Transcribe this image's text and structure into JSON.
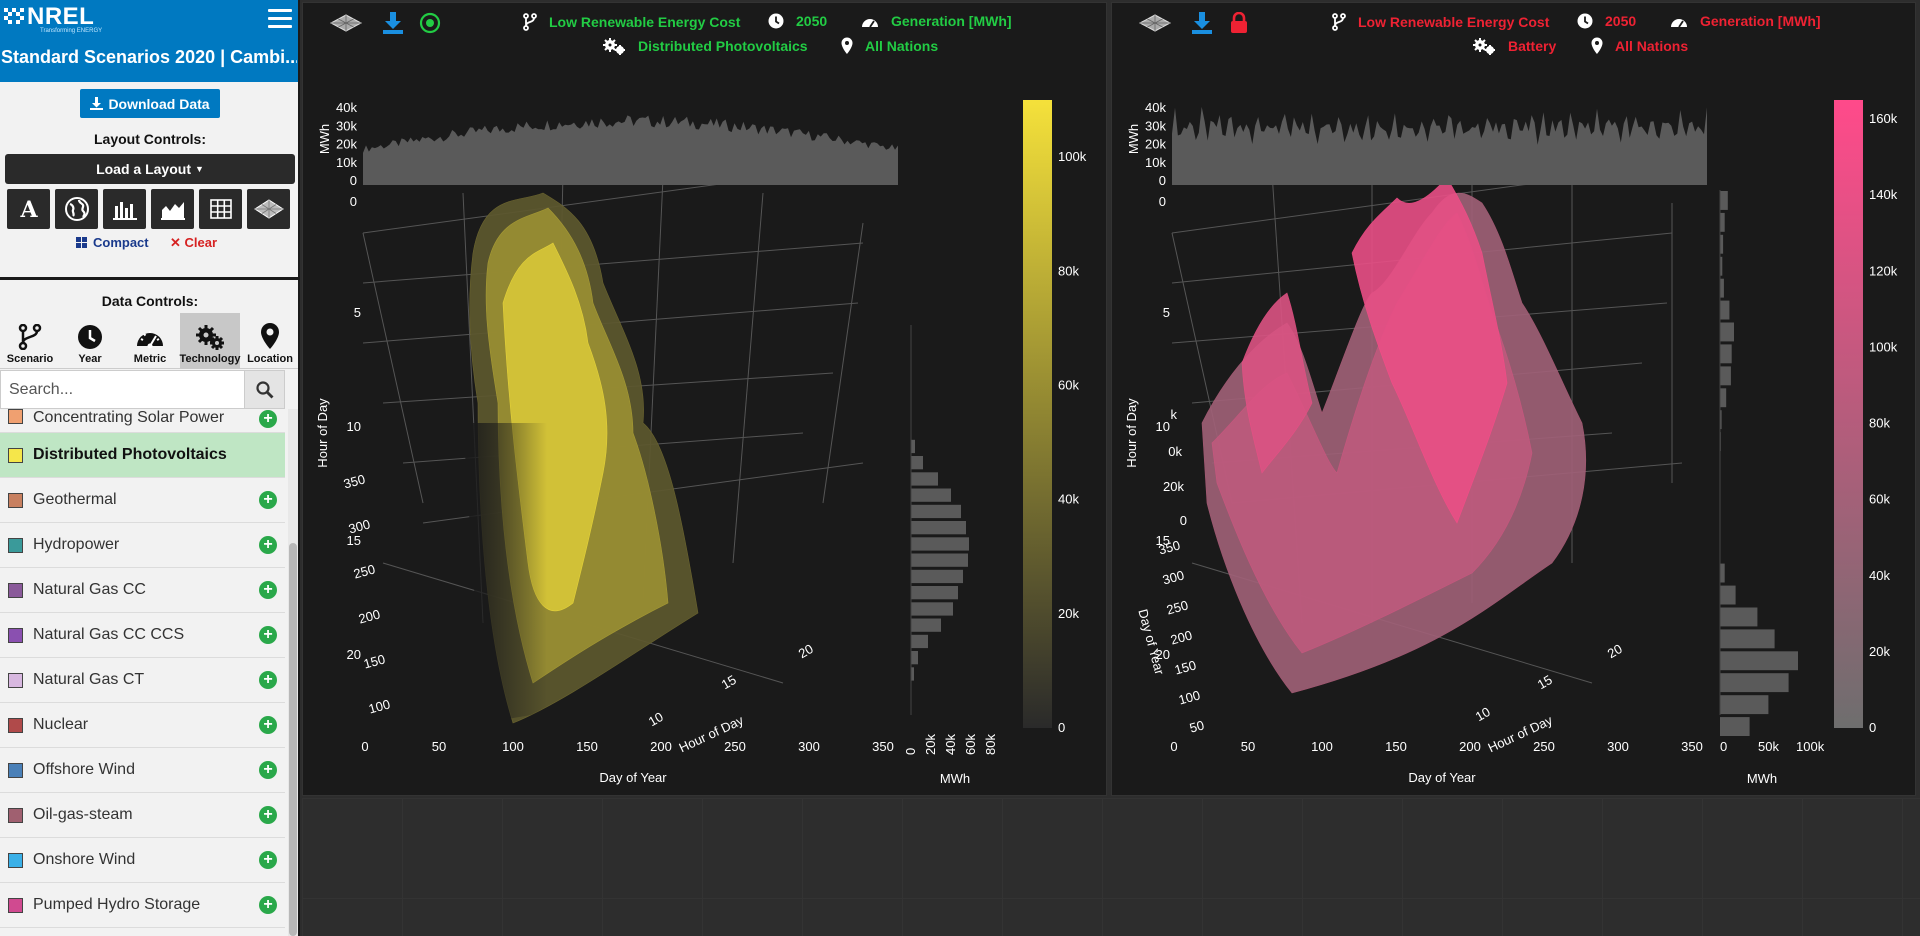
{
  "sidebar": {
    "logo_text": "NREL",
    "logo_tagline": "Transforming ENERGY",
    "title": "Standard Scenarios 2020 | Cambi...",
    "download_label": "Download Data",
    "layout_controls_label": "Layout Controls:",
    "load_layout_label": "Load a Layout",
    "layout_icons": [
      "text-icon",
      "globe-icon",
      "bar-chart-icon",
      "area-chart-icon",
      "table-icon",
      "surface-icon"
    ],
    "compact_label": "Compact",
    "clear_label": "Clear",
    "data_controls_label": "Data Controls:",
    "tabs": [
      {
        "label": "Scenario",
        "icon": "branch-icon"
      },
      {
        "label": "Year",
        "icon": "clock-icon"
      },
      {
        "label": "Metric",
        "icon": "gauge-icon"
      },
      {
        "label": "Technology",
        "icon": "gears-icon"
      },
      {
        "label": "Location",
        "icon": "map-pin-icon"
      }
    ],
    "active_tab": "Technology",
    "search_placeholder": "Search...",
    "technologies": [
      {
        "name": "Concentrating Solar Power",
        "color": "#f0a070"
      },
      {
        "name": "Distributed Photovoltaics",
        "color": "#f5e64a"
      },
      {
        "name": "Geothermal",
        "color": "#c88060"
      },
      {
        "name": "Hydropower",
        "color": "#3a9a9a"
      },
      {
        "name": "Natural Gas CC",
        "color": "#8a5a9a"
      },
      {
        "name": "Natural Gas CC CCS",
        "color": "#8a50b0"
      },
      {
        "name": "Natural Gas CT",
        "color": "#d8b8e0"
      },
      {
        "name": "Nuclear",
        "color": "#b04a4a"
      },
      {
        "name": "Offshore Wind",
        "color": "#4a80b8"
      },
      {
        "name": "Oil-gas-steam",
        "color": "#a06070"
      },
      {
        "name": "Onshore Wind",
        "color": "#3ab0e8"
      },
      {
        "name": "Pumped Hydro Storage",
        "color": "#d04a90"
      }
    ],
    "selected_technology": "Distributed Photovoltaics"
  },
  "panels": [
    {
      "accent": "#22cc44",
      "scenario": "Low Renewable Energy Cost",
      "year": "2050",
      "metric": "Generation [MWh]",
      "technology": "Distributed Photovoltaics",
      "location": "All Nations",
      "status_icon": "target-icon"
    },
    {
      "accent": "#ee2233",
      "scenario": "Low Renewable Energy Cost",
      "year": "2050",
      "metric": "Generation [MWh]",
      "technology": "Battery",
      "location": "All Nations",
      "status_icon": "lock-icon"
    }
  ],
  "chart_data": [
    {
      "type": "surface",
      "colorscale": [
        "#2a2a2a",
        "#f5e13a"
      ],
      "colorbar_ticks": [
        "0",
        "20k",
        "40k",
        "60k",
        "80k",
        "100k"
      ],
      "colorbar_max": 110000,
      "top_histogram": {
        "ylabel": "MWh",
        "ticks": [
          "40k",
          "30k",
          "20k",
          "10k",
          "0"
        ]
      },
      "side_histogram": {
        "xlabel": "MWh",
        "ticks": [
          "0",
          "20k",
          "40k",
          "60k",
          "80k"
        ],
        "values_by_hour": [
          0,
          0,
          0,
          0,
          0,
          0,
          0,
          4000,
          12000,
          27000,
          40000,
          50000,
          55000,
          58000,
          57000,
          52000,
          47000,
          42000,
          30000,
          17000,
          7000,
          3000,
          0,
          0
        ]
      },
      "xlabel": "Day of Year",
      "ylabel": "Hour of Day",
      "x_ticks": [
        "0",
        "50",
        "100",
        "150",
        "200",
        "250",
        "300",
        "350"
      ],
      "y_ticks": [
        "0",
        "5",
        "10",
        "15",
        "20"
      ],
      "scene_labels": {
        "hour_ticks": [
          "10",
          "15",
          "20"
        ],
        "day_ticks": [
          "100",
          "150",
          "200",
          "250",
          "300",
          "350"
        ],
        "hour_title": "Hour of Day"
      }
    },
    {
      "type": "surface",
      "colorscale": [
        "#6e6e6e",
        "#ff4a8a"
      ],
      "colorbar_ticks": [
        "0",
        "20k",
        "40k",
        "60k",
        "80k",
        "100k",
        "120k",
        "140k",
        "160k"
      ],
      "colorbar_max": 165000,
      "top_histogram": {
        "ylabel": "MWh",
        "ticks": [
          "40k",
          "30k",
          "20k",
          "10k",
          "0"
        ]
      },
      "side_histogram": {
        "xlabel": "MWh",
        "ticks": [
          "0",
          "50k",
          "100k"
        ],
        "values_by_hour": [
          10000,
          6000,
          4000,
          3000,
          5000,
          12000,
          18000,
          15000,
          14000,
          8000,
          2000,
          1000,
          0,
          0,
          0,
          0,
          0,
          6000,
          20000,
          48000,
          70000,
          100000,
          88000,
          62000,
          38000
        ]
      },
      "xlabel": "Day of Year",
      "ylabel": "Hour of Day",
      "x_ticks": [
        "0",
        "50",
        "100",
        "150",
        "200",
        "250",
        "300",
        "350"
      ],
      "y_ticks": [
        "0",
        "5",
        "10",
        "15",
        "20"
      ],
      "scene_labels": {
        "hour_ticks": [
          "10",
          "15",
          "20"
        ],
        "day_ticks": [
          "50",
          "100",
          "150",
          "200",
          "250",
          "300",
          "350"
        ],
        "hour_title": "Hour of Day",
        "day_title": "Day of Year",
        "z_ticks": [
          "0",
          "20k",
          "0k",
          "k"
        ]
      }
    }
  ]
}
